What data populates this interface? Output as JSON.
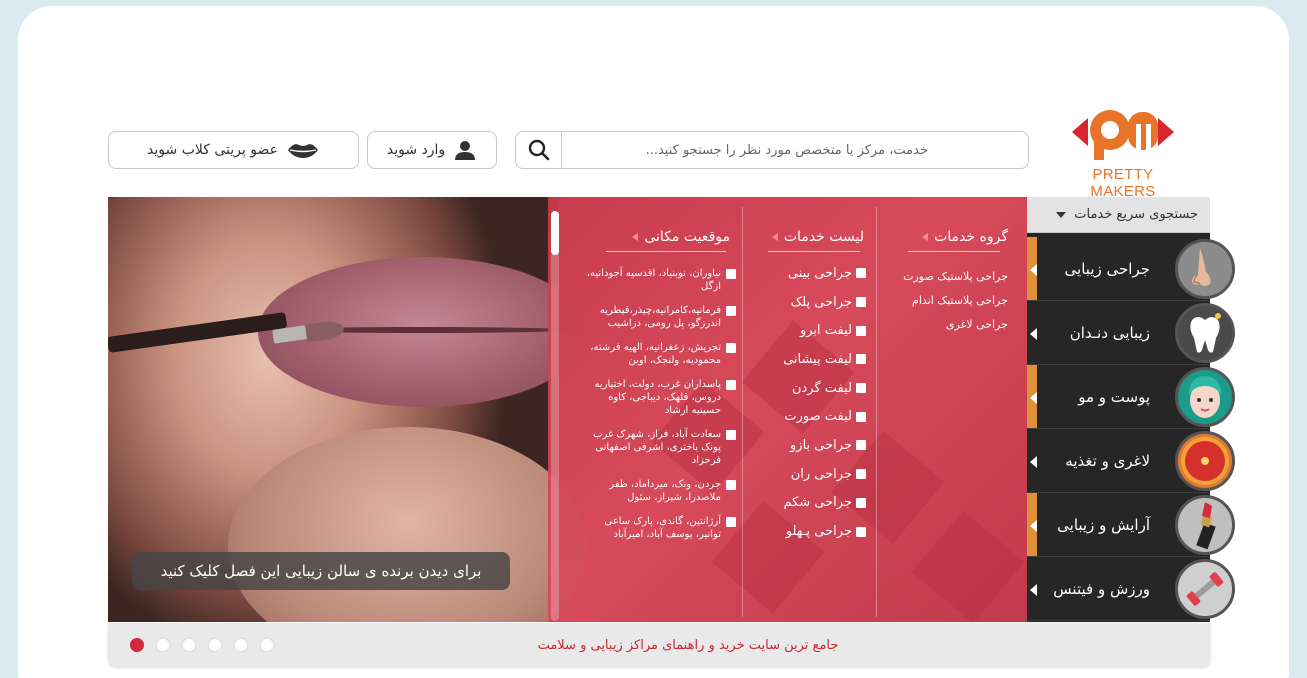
{
  "brand": {
    "name": "PRETTY MAKERS",
    "color": "#e8742a"
  },
  "search": {
    "placeholder": "خدمت، مرکز یا متخصص مورد نظر را جستجو کنید..."
  },
  "header": {
    "login_label": "وارد شوید",
    "join_label": "عضو پریتی کلاب شوید"
  },
  "hero": {
    "cta": "برای دیدن برنده ی سالن زیبایی این فصل کلیک کنید",
    "columns": {
      "group_title": "گروه خدمات",
      "services_title": "لیست خدمات",
      "location_title": "موقعیت مکانی"
    },
    "groups": [
      "جراحی پلاستیک صورت",
      "جراحی پلاستیک اندام",
      "جراحی لاغری"
    ],
    "services": [
      "جراحی بینی",
      "جراحی پلک",
      "لیفت ابرو",
      "لیفت پیشانی",
      "لیفت گردن",
      "لیفت صورت",
      "جراحی بازو",
      "جراحی ران",
      "جراحی شکم",
      "جراحی پـهلو"
    ],
    "locations": [
      "نیاوران، نوبنیاد، اقدسیه آجودانیه، ازگل",
      "فرمانیه،کامرانیه،چیذر،قیطریه اندرزگو، پل رومی، دزاشیب",
      "تجریش، زعفرانیه، الهیه فرشته، محمودیه، ولنجک، اوین",
      "پاسداران غرب، دولت، اختیاریه دروس، قلهک، دیباجی، کاوه حسینیه ارشاد",
      "سعادت آباد، فراز، شهرک غرب پونک باختری، اشرفی اصفهانی فرحزاد",
      "جردن، ونک، میرداماد، ظفر ملاصدرا، شیراز، سئول",
      "آرژانتین، گاندی، پارک ساعی توانیر، یوسف آباد، امیرآباد"
    ]
  },
  "sidebar": {
    "quick_search": "جستجوی سریع خدمات",
    "categories": [
      {
        "label": "جراحی زیبایی",
        "icon": "nose-icon"
      },
      {
        "label": "زیبایی دنـدان",
        "icon": "tooth-icon"
      },
      {
        "label": "پوست و مو",
        "icon": "face-icon"
      },
      {
        "label": "لاغری و تغذیه",
        "icon": "grapefruit-icon"
      },
      {
        "label": "آرایش و زیبایی",
        "icon": "lipstick-icon"
      },
      {
        "label": "ورزش و فیتنس",
        "icon": "dumbbell-icon"
      }
    ]
  },
  "footer": {
    "tagline": "جامع ترین سایت خرید و راهنمای مراکز زیبایی و سلامت",
    "slides": 6,
    "active_slide": 1
  },
  "colors": {
    "accent": "#d2283a",
    "sidebar": "#262626",
    "sidebar_bar": "#e0903a"
  }
}
